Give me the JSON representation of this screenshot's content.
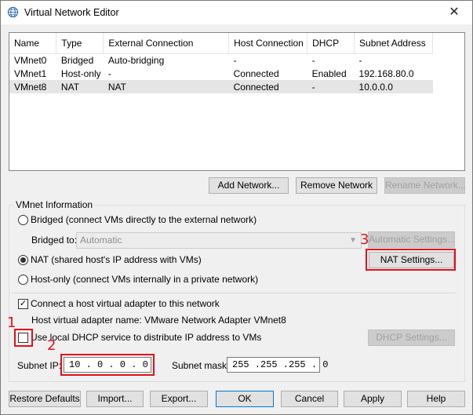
{
  "window": {
    "title": "Virtual Network Editor",
    "close_glyph": "✕"
  },
  "network_table": {
    "headers": [
      "Name",
      "Type",
      "External Connection",
      "Host Connection",
      "DHCP",
      "Subnet Address"
    ],
    "rows": [
      [
        "VMnet0",
        "Bridged",
        "Auto-bridging",
        "-",
        "-",
        "-"
      ],
      [
        "VMnet1",
        "Host-only",
        "-",
        "Connected",
        "Enabled",
        "192.168.80.0"
      ],
      [
        "VMnet8",
        "NAT",
        "NAT",
        "Connected",
        "-",
        "10.0.0.0"
      ]
    ],
    "selected_row": 2
  },
  "list_buttons": {
    "add": "Add Network...",
    "remove": "Remove Network",
    "rename": "Rename Network..."
  },
  "vmnet_info": {
    "group_label": "VMnet Information",
    "bridged_label": "Bridged (connect VMs directly to the external network)",
    "bridged_to_label": "Bridged to:",
    "bridged_to_value": "Automatic",
    "automatic_settings": "Automatic Settings...",
    "nat_label": "NAT (shared host's IP address with VMs)",
    "nat_settings": "NAT Settings...",
    "hostonly_label": "Host-only (connect VMs internally in a private network)",
    "connect_adapter_label": "Connect a host virtual adapter to this network",
    "connect_adapter_checked": true,
    "adapter_name_label": "Host virtual adapter name: VMware Network Adapter VMnet8",
    "dhcp_label": "Use local DHCP service to distribute IP address to VMs",
    "dhcp_checked": false,
    "dhcp_settings": "DHCP Settings...",
    "subnet_ip_label": "Subnet IP:",
    "subnet_ip_value": "10 . 0 . 0 . 0",
    "subnet_mask_label": "Subnet mask:",
    "subnet_mask_value": "255 .255 .255 . 0",
    "selected_mode": "nat"
  },
  "annotations": {
    "one": "1",
    "two": "2",
    "three": "3"
  },
  "footer_buttons": {
    "restore": "Restore Defaults",
    "import": "Import...",
    "export": "Export...",
    "ok": "OK",
    "cancel": "Cancel",
    "apply": "Apply",
    "help": "Help"
  },
  "colors": {
    "annotation": "#e0111b",
    "selected_row": "#e5e5e5",
    "default_button_border": "#0078d7"
  },
  "icons": {
    "title": "globe-network-icon",
    "combo": "chevron-down-icon"
  }
}
